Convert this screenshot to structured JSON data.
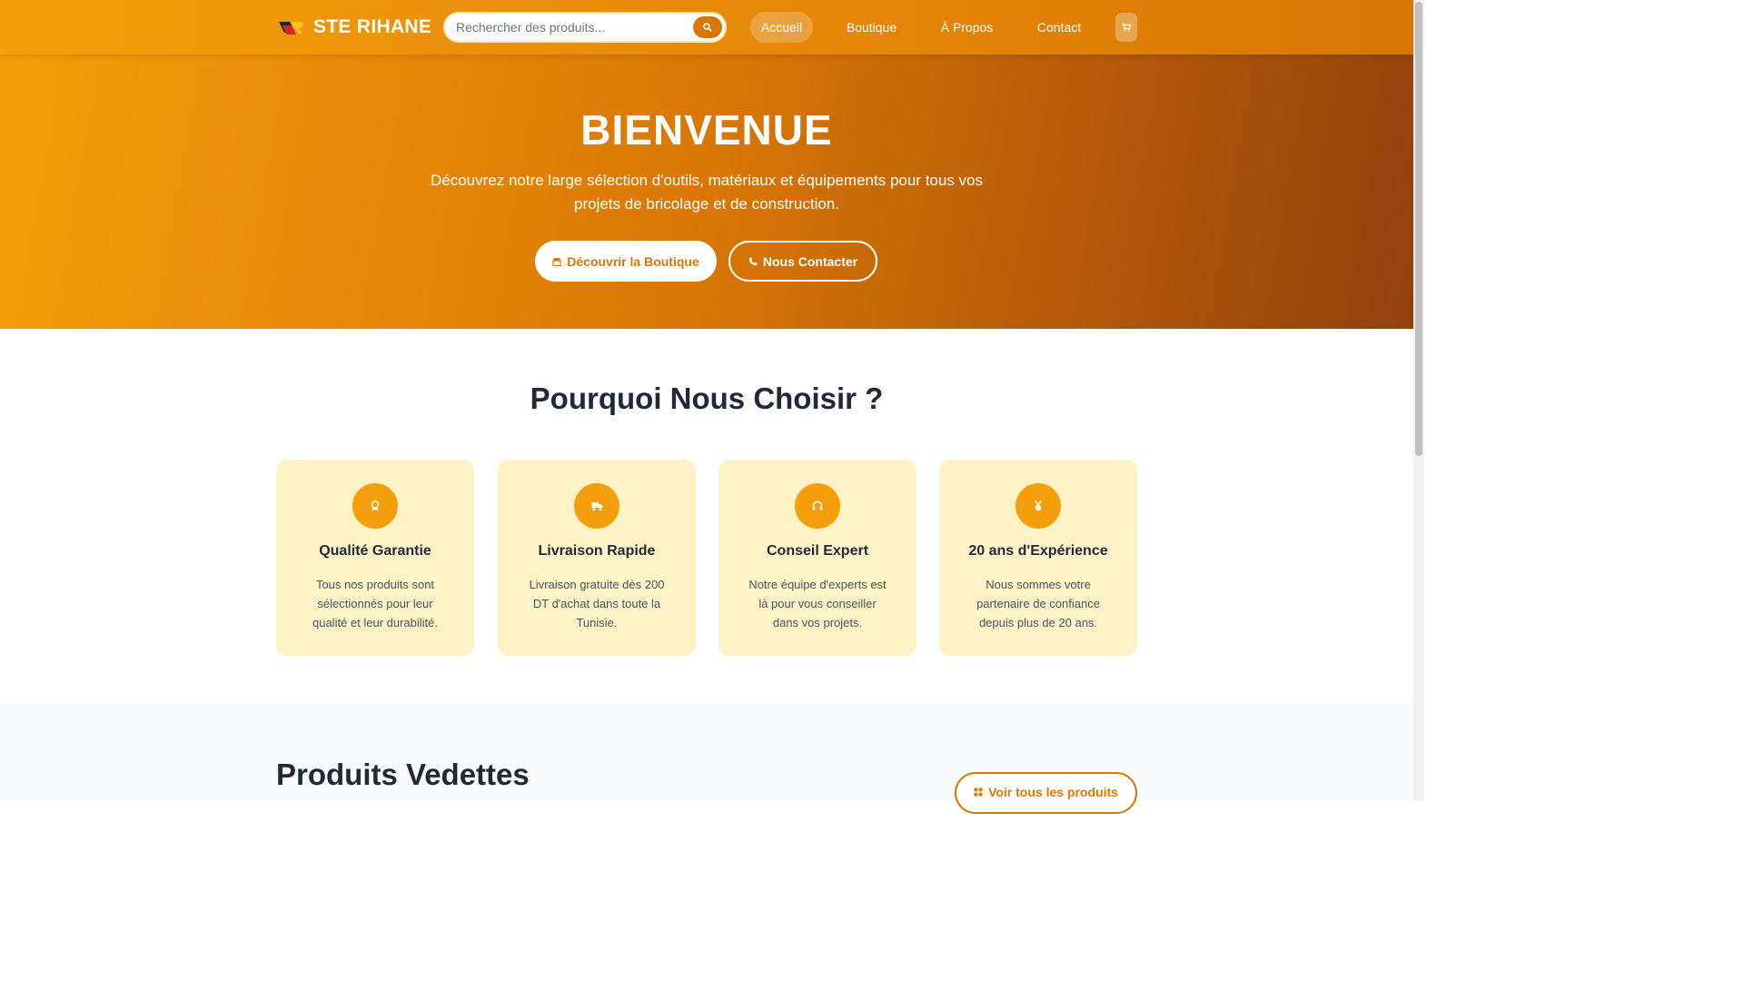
{
  "header": {
    "brand_name": "STE RIHANE",
    "search_placeholder": "Rechercher des produits...",
    "nav": [
      {
        "label": "Accueil",
        "active": true
      },
      {
        "label": "Boutique",
        "active": false
      },
      {
        "label": "À Propos",
        "active": false
      },
      {
        "label": "Contact",
        "active": false
      }
    ],
    "icons": {
      "search": "search-icon",
      "cart": "cart-icon"
    }
  },
  "hero": {
    "title": "BIENVENUE",
    "subtitle": "Découvrez notre large sélection d'outils, matériaux et équipements pour tous vos projets de bricolage et de construction.",
    "primary_button": "Découvrir la Boutique",
    "secondary_button": "Nous Contacter"
  },
  "why": {
    "title": "Pourquoi Nous Choisir ?",
    "cards": [
      {
        "icon": "award-icon",
        "title": "Qualité Garantie",
        "text": "Tous nos produits sont sélectionnés pour leur qualité et leur durabilité."
      },
      {
        "icon": "truck-icon",
        "title": "Livraison Rapide",
        "text": "Livraison gratuite dès 200 DT d'achat dans toute la Tunisie."
      },
      {
        "icon": "headset-icon",
        "title": "Conseil Expert",
        "text": "Notre équipe d'experts est là pour vous conseiller dans vos projets."
      },
      {
        "icon": "medal-icon",
        "title": "20 ans d'Expérience",
        "text": "Nous sommes votre partenaire de confiance depuis plus de 20 ans."
      }
    ]
  },
  "featured": {
    "title": "Produits Vedettes",
    "see_all": "Voir tous les produits"
  },
  "colors": {
    "primary": "#f59e0b",
    "primary_dark": "#d97706",
    "card_bg": "#fef3c7"
  }
}
